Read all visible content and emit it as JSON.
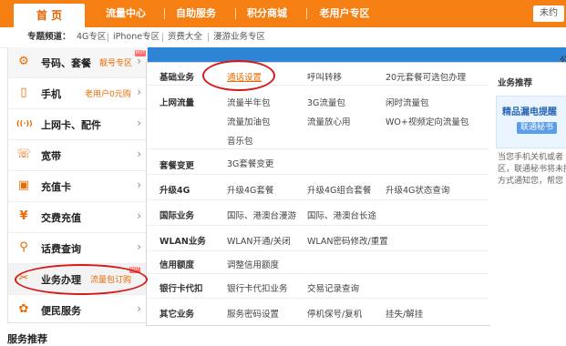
{
  "topnav": {
    "tabs": [
      {
        "label": "首  页"
      },
      {
        "label": "流量中心"
      },
      {
        "label": "自助服务"
      },
      {
        "label": "积分商城"
      },
      {
        "label": "老用户专区"
      }
    ],
    "login": "未约"
  },
  "channels": {
    "label": "专题频道：",
    "links": [
      "4G专区",
      "iPhone专区",
      "资费大全",
      "漫游业务专区"
    ]
  },
  "leftmenu": {
    "items": [
      {
        "label": "号码、套餐",
        "tag": "靓号专区",
        "icon": "gear-icon",
        "glyph": "⚙"
      },
      {
        "label": "手机",
        "tag": "老用户0元购",
        "icon": "phone-icon",
        "glyph": "▯"
      },
      {
        "label": "上网卡、配件",
        "tag": "",
        "icon": "signal-icon",
        "glyph": "((·))"
      },
      {
        "label": "宽带",
        "tag": "",
        "icon": "handset-icon",
        "glyph": "☏"
      },
      {
        "label": "充值卡",
        "tag": "",
        "icon": "card-icon",
        "glyph": "▣"
      },
      {
        "label": "交费充值",
        "tag": "",
        "icon": "yen-icon",
        "glyph": "¥"
      },
      {
        "label": "话费查询",
        "tag": "",
        "icon": "search-icon",
        "glyph": "⚲"
      },
      {
        "label": "业务办理",
        "tag": "流量包订购",
        "icon": "tools-icon",
        "glyph": "✂"
      },
      {
        "label": "便民服务",
        "tag": "",
        "icon": "service-icon",
        "glyph": "✿"
      }
    ],
    "hot": "HOT"
  },
  "panel": {
    "rows": [
      {
        "cat": "基础业务",
        "links": [
          "通话设置",
          "呼叫转移",
          "20元套餐可选包办理"
        ]
      },
      {
        "cat": "上网流量",
        "links": [
          "流量半年包",
          "3G流量包",
          "闲时流量包",
          "流量加油包",
          "流量放心用",
          "WO+视频定向流量包",
          "音乐包"
        ]
      },
      {
        "cat": "套餐变更",
        "links": [
          "3G套餐变更"
        ]
      },
      {
        "cat": "升级4G",
        "links": [
          "升级4G套餐",
          "升级4G组合套餐",
          "升级4G状态查询"
        ]
      },
      {
        "cat": "国际业务",
        "links": [
          "国际、港澳台漫游",
          "国际、港澳台长途"
        ]
      },
      {
        "cat": "WLAN业务",
        "links": [
          "WLAN开通/关闭",
          "WLAN密码修改/重置"
        ]
      },
      {
        "cat": "信用额度",
        "links": [
          "调整信用额度"
        ]
      },
      {
        "cat": "银行卡代扣",
        "links": [
          "银行卡代扣业务",
          "交易记录查询"
        ]
      },
      {
        "cat": "其它业务",
        "links": [
          "服务密码设置",
          "停机保号/复机",
          "挂失/解挂"
        ]
      }
    ]
  },
  "recommend": {
    "title": "业务推荐",
    "promo_title": "精品漏电提醒",
    "promo_button": "联通秘书",
    "desc": [
      "当您手机关机或者",
      "区，联通秘书将未接",
      "方式通知您，帮您"
    ]
  },
  "banner_text": "公",
  "bottom_title": "服务推荐",
  "colors": {
    "brand": "#f57f12",
    "annotation": "#d51a1a",
    "banner": "#2f85d5"
  }
}
